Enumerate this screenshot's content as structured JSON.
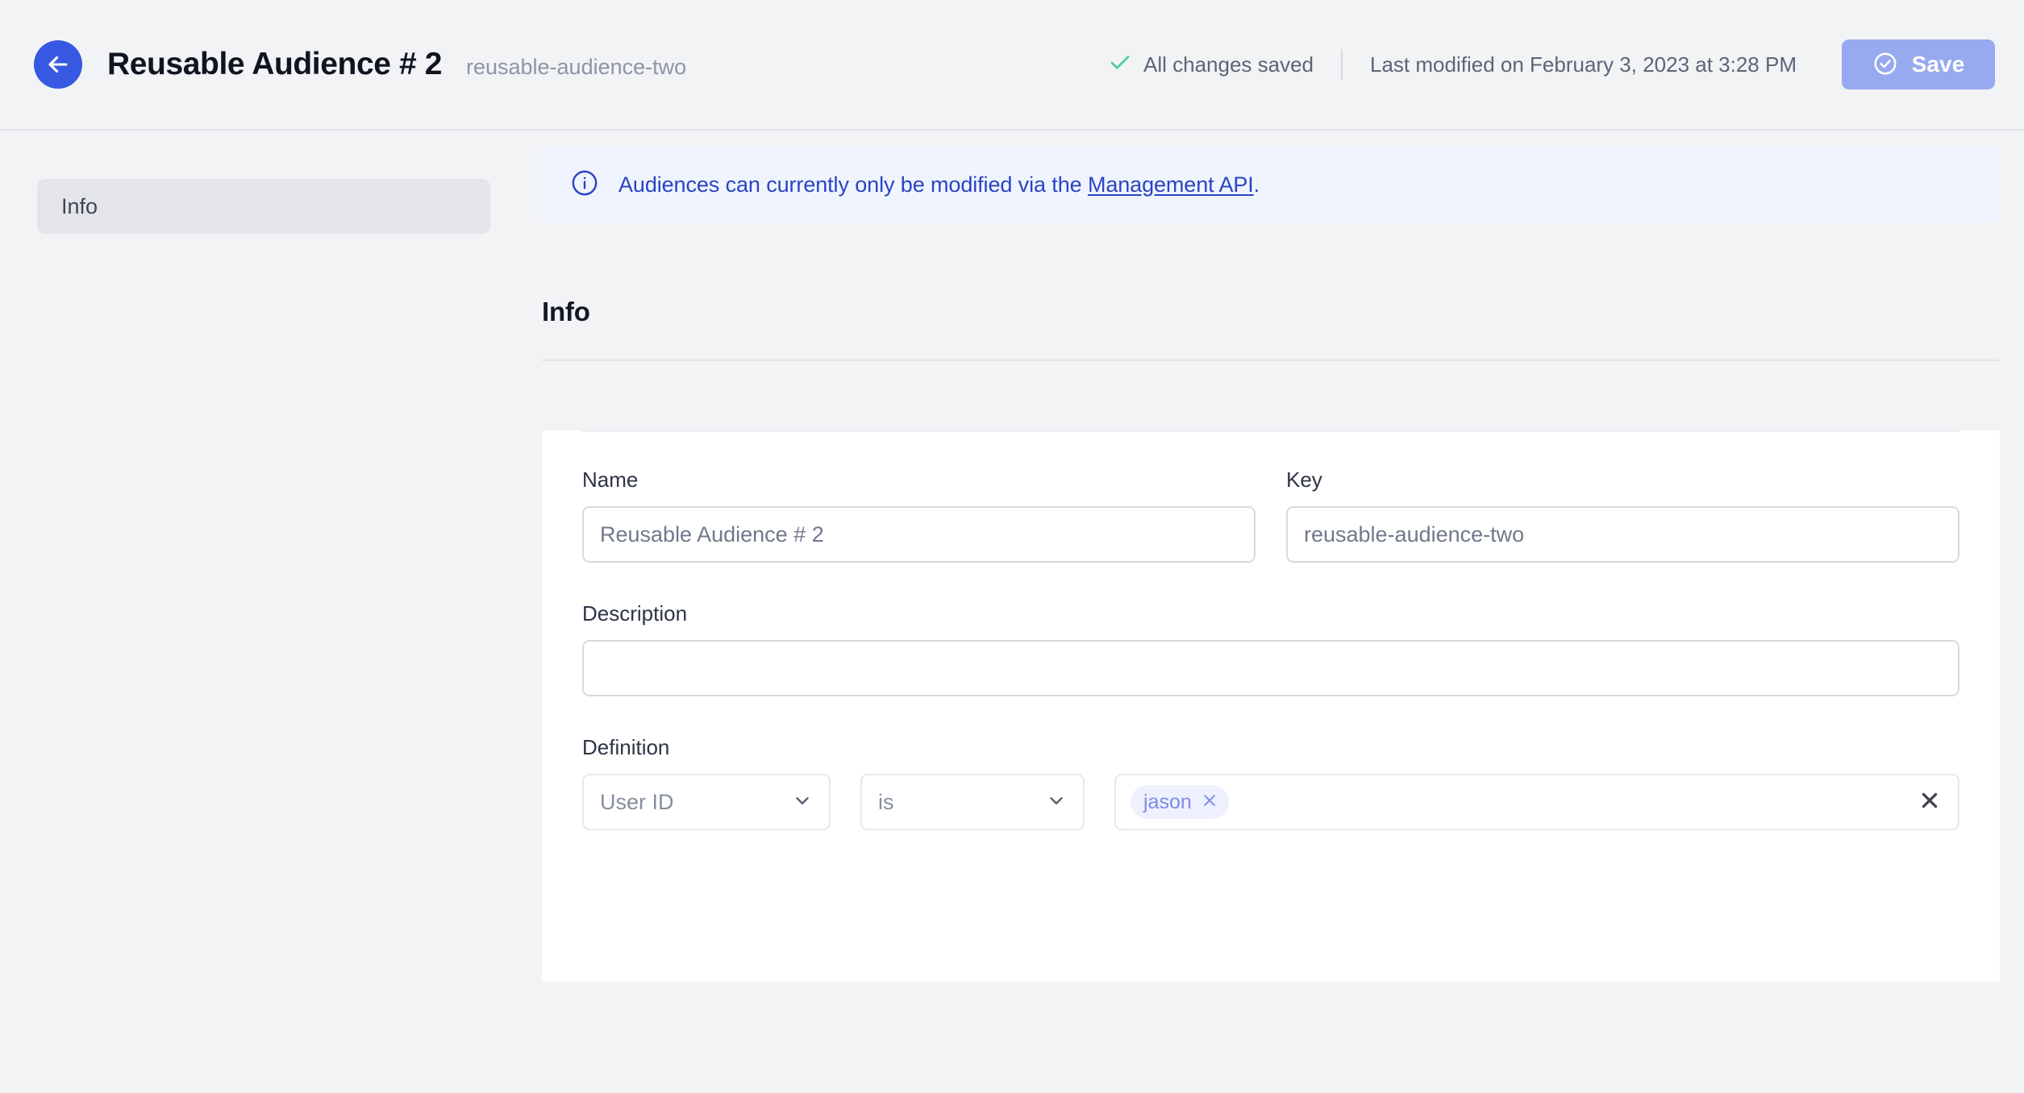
{
  "header": {
    "back_icon": "arrow-left-icon",
    "title": "Reusable Audience # 2",
    "key": "reusable-audience-two",
    "saved_status": "All changes saved",
    "saved_icon": "check-icon",
    "last_modified": "Last modified on February 3, 2023 at 3:28 PM",
    "save_label": "Save",
    "save_icon": "check-circle-icon"
  },
  "sidebar": {
    "items": [
      {
        "label": "Info",
        "active": true
      }
    ]
  },
  "banner": {
    "icon": "info-circle-icon",
    "text_before": "Audiences can currently only be modified via the ",
    "link_text": "Management API",
    "text_after": "."
  },
  "section": {
    "heading": "Info"
  },
  "form": {
    "name": {
      "label": "Name",
      "value": "Reusable Audience # 2"
    },
    "key": {
      "label": "Key",
      "value": "reusable-audience-two"
    },
    "description": {
      "label": "Description",
      "value": "",
      "placeholder": ""
    },
    "definition": {
      "label": "Definition",
      "attribute": "User ID",
      "operator": "is",
      "values": [
        {
          "label": "jason",
          "remove_icon": "close-icon"
        }
      ],
      "clear_icon": "close-icon",
      "chevron_icon": "chevron-down-icon"
    }
  },
  "colors": {
    "accent": "#3758e0",
    "save_button": "#97a9ef",
    "banner_bg": "#eff4fe",
    "banner_text": "#2a43c4",
    "check_green": "#4ecfa6",
    "tag_bg": "#eef1fd",
    "tag_text": "#7b8ce8",
    "page_bg": "#f1f3f5"
  }
}
